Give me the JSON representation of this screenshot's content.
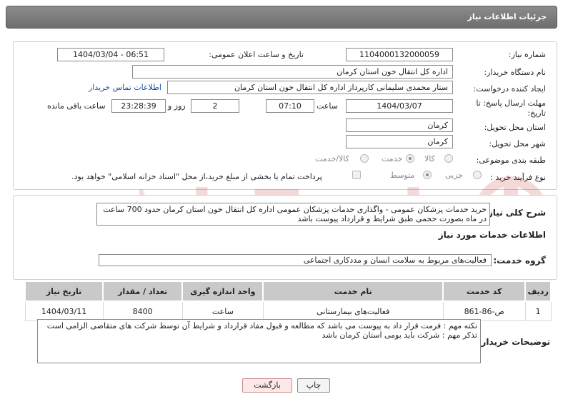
{
  "header": {
    "title": "جزئیات اطلاعات نیاز"
  },
  "form": {
    "need_number_label": "شماره نیاز:",
    "need_number": "1104000132000059",
    "announce_label": "تاریخ و ساعت اعلان عمومی:",
    "announce_value": "1404/03/04 - 06:51",
    "buyer_org_label": "نام دستگاه خریدار:",
    "buyer_org": "اداره کل انتقال خون استان کرمان",
    "creator_label": "ایجاد کننده درخواست:",
    "creator": "ستار محمدی سلیمانی کارپرداز اداره کل انتقال خون استان کرمان",
    "contact_link": "اطلاعات تماس خریدار",
    "deadline_label_1": "مهلت ارسال پاسخ: تا",
    "deadline_label_2": "تاریخ:",
    "deadline_date": "1404/03/07",
    "time_label": "ساعت",
    "deadline_time": "07:10",
    "days_value": "2",
    "days_label": "روز و",
    "remaining_time": "23:28:39",
    "remaining_label": "ساعت باقی مانده",
    "province_label": "استان محل تحویل:",
    "province": "کرمان",
    "city_label": "شهر محل تحویل:",
    "city": "کرمان",
    "category_label": "طبقه بندی موضوعی:",
    "category_options": [
      "کالا",
      "خدمت",
      "کالا/خدمت"
    ],
    "category_selected": "خدمت",
    "process_label": "نوع فرآیند خرید :",
    "process_options": [
      "جزیی",
      "متوسط"
    ],
    "process_selected": "متوسط",
    "payment_note": "پرداخت تمام یا بخشی از مبلغ خرید،از محل \"اسناد خزانه اسلامی\" خواهد بود."
  },
  "summary": {
    "label": "شرح کلی نیاز:",
    "text": "خرید خدمات پزشکان عمومی - واگذاری خدمات پزشکان عمومی اداره کل انتقال خون استان کرمان حدود 700 ساعت در ماه بصورت حجمی طبق شرایط و قرارداد پیوست باشد"
  },
  "services": {
    "section_title": "اطلاعات خدمات مورد نیاز",
    "group_label": "گروه خدمت:",
    "group_value": "فعالیت‌های مربوط به سلامت انسان و مددکاری اجتماعی",
    "columns": [
      "ردیف",
      "کد خدمت",
      "نام خدمت",
      "واحد اندازه گیری",
      "تعداد / مقدار",
      "تاریخ نیاز"
    ],
    "rows": [
      [
        "1",
        "ص-86-861",
        "فعالیت‌های بیمارستانی",
        "ساعت",
        "8400",
        "1404/03/11"
      ]
    ]
  },
  "buyer_notes": {
    "label": "توضیحات خریدار:",
    "line1": "نکته مهم : فرمت قرار داد به پیوست می باشد که مطالعه و قبول مفاد قرارداد و شرایط آن توسط شرکت های متقاضی الزامی است",
    "line2": "تذکر مهم : شرکت باید بومی استان کرمان باشد"
  },
  "buttons": {
    "print": "چاپ",
    "back": "بازگشت"
  },
  "colors": {
    "header": "#7a7a7a",
    "link": "#1a4fa3",
    "back_button": "#fde8e8",
    "print_button": "#f4f4f4"
  }
}
